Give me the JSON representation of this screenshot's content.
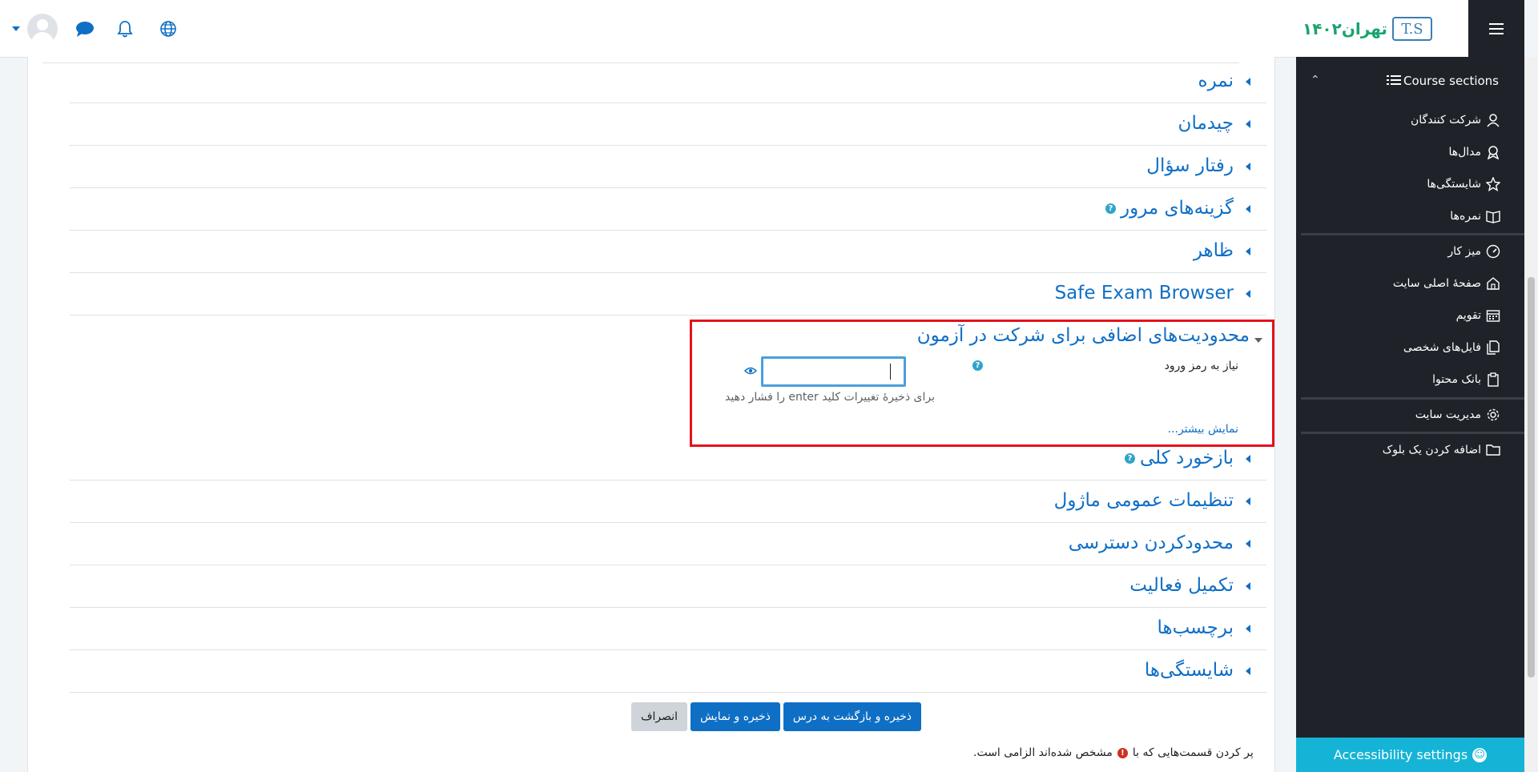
{
  "navbar": {
    "brand_text": "تهران۱۴۰۲",
    "brand_ts": "T.S",
    "icons": [
      "user-menu-caret-icon",
      "avatar",
      "chat-icon",
      "bell-icon",
      "globe-icon",
      "hamburger-icon"
    ]
  },
  "drawer": {
    "course_sections": "Course sections",
    "items": [
      {
        "label": "شرکت کنندگان",
        "icon": "participants-icon"
      },
      {
        "label": "مدال‌ها",
        "icon": "badge-icon"
      },
      {
        "label": "شایستگی‌ها",
        "icon": "star-icon"
      },
      {
        "label": "نمره‌ها",
        "icon": "gradebook-icon"
      },
      {
        "label": "میز کار",
        "icon": "dashboard-icon"
      },
      {
        "label": "صفحهٔ اصلی سایت",
        "icon": "home-icon"
      },
      {
        "label": "تقویم",
        "icon": "calendar-icon"
      },
      {
        "label": "فایل‌های شخصی",
        "icon": "files-icon"
      },
      {
        "label": "بانک محتوا",
        "icon": "content-bank-icon"
      },
      {
        "label": "مدیریت سایت",
        "icon": "gear-icon"
      },
      {
        "label": "اضافه کردن یک بلوک",
        "icon": "folder-icon"
      }
    ],
    "accessibility": "Accessibility settings"
  },
  "sections": [
    {
      "title": "نمره",
      "help": false
    },
    {
      "title": "چیدمان",
      "help": false
    },
    {
      "title": "رفتار سؤال",
      "help": false
    },
    {
      "title": "گزینه‌های مرور",
      "help": true
    },
    {
      "title": "ظاهر",
      "help": false
    },
    {
      "title": "Safe Exam Browser",
      "help": false
    }
  ],
  "expanded_section": {
    "title": "محدودیت‌های اضافی برای شرکت در آزمون",
    "password_label": "نیاز به رمز ورود",
    "password_value": "",
    "hint": "برای ذخیرهٔ تغییرات کلید enter را فشار دهید",
    "show_more": "نمایش بیشتر..."
  },
  "sections_after": [
    {
      "title": "بازخورد کلی",
      "help": true
    },
    {
      "title": "تنظیمات عمومی ماژول",
      "help": false
    },
    {
      "title": "محدودکردن دسترسی",
      "help": false
    },
    {
      "title": "تکمیل فعالیت",
      "help": false
    },
    {
      "title": "برچسب‌ها",
      "help": false
    },
    {
      "title": "شایستگی‌ها",
      "help": false
    }
  ],
  "buttons": {
    "save_return": "ذخیره و بازگشت به درس",
    "save_display": "ذخیره و نمایش",
    "cancel": "انصراف"
  },
  "required_note": {
    "before": "پر کردن قسمت‌هایی که با",
    "after": "مشخص شده‌اند الزامی است."
  },
  "colors": {
    "link": "#0f6fc5",
    "drawer_bg": "#1f2329",
    "highlight_border": "#e3121b",
    "accessibility_bg": "#15b4d6"
  }
}
